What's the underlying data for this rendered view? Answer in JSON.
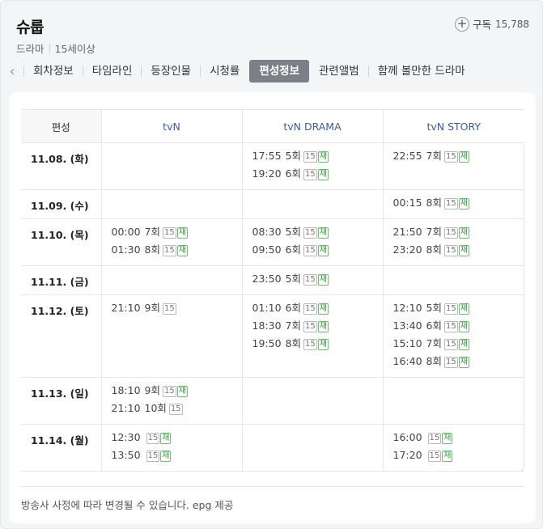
{
  "program": {
    "title": "슈룹",
    "genre": "드라마",
    "rating": "15세이상"
  },
  "subscribe": {
    "label": "구독",
    "count": "15,788"
  },
  "tabs": [
    "회차정보",
    "타임라인",
    "등장인물",
    "시청률",
    "편성정보",
    "관련앨범",
    "함께 볼만한 드라마"
  ],
  "active_tab": "편성정보",
  "table": {
    "headers": [
      "편성",
      "tvN",
      "tvN DRAMA",
      "tvN STORY"
    ],
    "rows": [
      {
        "date": "11.08. (화)",
        "cols": [
          [],
          [
            {
              "time": "17:55",
              "ep": "5회",
              "rating": "15",
              "re": "재"
            },
            {
              "time": "19:20",
              "ep": "6회",
              "rating": "15",
              "re": "재"
            }
          ],
          [
            {
              "time": "22:55",
              "ep": "7회",
              "rating": "15",
              "re": "재"
            }
          ]
        ]
      },
      {
        "date": "11.09. (수)",
        "cols": [
          [],
          [],
          [
            {
              "time": "00:15",
              "ep": "8회",
              "rating": "15",
              "re": "재"
            }
          ]
        ]
      },
      {
        "date": "11.10. (목)",
        "cols": [
          [
            {
              "time": "00:00",
              "ep": "7회",
              "rating": "15",
              "re": "재"
            },
            {
              "time": "01:30",
              "ep": "8회",
              "rating": "15",
              "re": "재"
            }
          ],
          [
            {
              "time": "08:30",
              "ep": "5회",
              "rating": "15",
              "re": "재"
            },
            {
              "time": "09:50",
              "ep": "6회",
              "rating": "15",
              "re": "재"
            }
          ],
          [
            {
              "time": "21:50",
              "ep": "7회",
              "rating": "15",
              "re": "재"
            },
            {
              "time": "23:20",
              "ep": "8회",
              "rating": "15",
              "re": "재"
            }
          ]
        ]
      },
      {
        "date": "11.11. (금)",
        "cols": [
          [],
          [
            {
              "time": "23:50",
              "ep": "5회",
              "rating": "15",
              "re": "재"
            }
          ],
          []
        ]
      },
      {
        "date": "11.12. (토)",
        "cols": [
          [
            {
              "time": "21:10",
              "ep": "9회",
              "rating": "15",
              "re": ""
            }
          ],
          [
            {
              "time": "01:10",
              "ep": "6회",
              "rating": "15",
              "re": "재"
            },
            {
              "time": "18:30",
              "ep": "7회",
              "rating": "15",
              "re": "재"
            },
            {
              "time": "19:50",
              "ep": "8회",
              "rating": "15",
              "re": "재"
            }
          ],
          [
            {
              "time": "12:10",
              "ep": "5회",
              "rating": "15",
              "re": "재"
            },
            {
              "time": "13:40",
              "ep": "6회",
              "rating": "15",
              "re": "재"
            },
            {
              "time": "15:10",
              "ep": "7회",
              "rating": "15",
              "re": "재"
            },
            {
              "time": "16:40",
              "ep": "8회",
              "rating": "15",
              "re": "재"
            }
          ]
        ]
      },
      {
        "date": "11.13. (일)",
        "cols": [
          [
            {
              "time": "18:10",
              "ep": "9회",
              "rating": "15",
              "re": "재"
            },
            {
              "time": "21:10",
              "ep": "10회",
              "rating": "15",
              "re": ""
            }
          ],
          [],
          []
        ]
      },
      {
        "date": "11.14. (월)",
        "cols": [
          [
            {
              "time": "12:30",
              "ep": "",
              "rating": "15",
              "re": "재"
            },
            {
              "time": "13:50",
              "ep": "",
              "rating": "15",
              "re": "재"
            }
          ],
          [],
          [
            {
              "time": "16:00",
              "ep": "",
              "rating": "15",
              "re": "재"
            },
            {
              "time": "17:20",
              "ep": "",
              "rating": "15",
              "re": "재"
            }
          ]
        ]
      }
    ]
  },
  "footer": "방송사 사정에 따라 변경될 수 있습니다. epg 제공"
}
